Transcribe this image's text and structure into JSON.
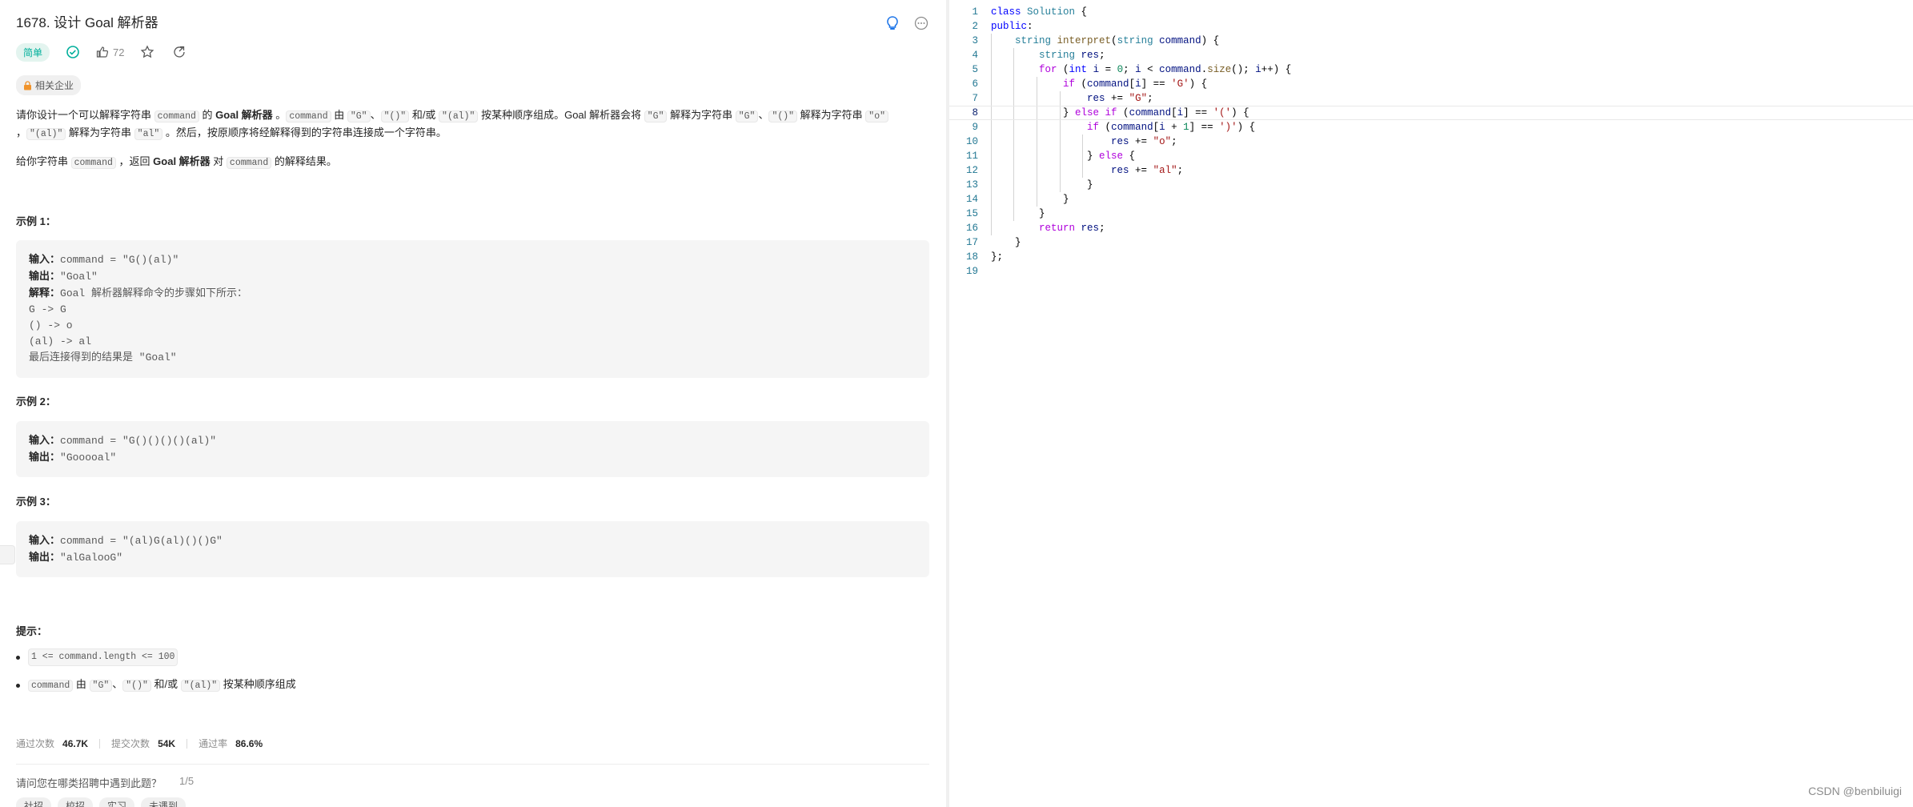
{
  "problem": {
    "title": "1678. 设计 Goal 解析器",
    "difficulty": "简单",
    "likes": "72",
    "company_tag": "相关企业"
  },
  "description": {
    "p1_a": "请你设计一个可以解释字符串 ",
    "p1_code1": "command",
    "p1_b": " 的 ",
    "p1_bold1": "Goal 解析器",
    "p1_c": " 。",
    "p1_code2": "command",
    "p1_d": " 由 ",
    "p1_code3": "\"G\"",
    "p1_e": "、",
    "p1_code4": "\"()\"",
    "p1_f": " 和/或 ",
    "p1_code5": "\"(al)\"",
    "p1_g": " 按某种顺序组成。Goal 解析器会将 ",
    "p1_code6": "\"G\"",
    "p1_h": " 解释为字符串 ",
    "p1_code7": "\"G\"",
    "p1_i": "、",
    "p1_code8": "\"()\"",
    "p1_j": " 解释为字符串 ",
    "p1_code9": "\"o\"",
    "p1_k": " ，",
    "p1_code10": "\"(al)\"",
    "p1_l": " 解释为字符串 ",
    "p1_code11": "\"al\"",
    "p1_m": " 。然后，按原顺序将经解释得到的字符串连接成一个字符串。",
    "p2_a": "给你字符串 ",
    "p2_code1": "command",
    "p2_b": " ，返回 ",
    "p2_bold1": "Goal 解析器",
    "p2_c": " 对 ",
    "p2_code2": "command",
    "p2_d": " 的解释结果。"
  },
  "examples": [
    {
      "title": "示例 1：",
      "input_label": "输入：",
      "input": "command = \"G()(al)\"",
      "output_label": "输出：",
      "output": "\"Goal\"",
      "explain_label": "解释：",
      "explain": "Goal 解析器解释命令的步骤如下所示：",
      "steps": [
        "G -> G",
        "() -> o",
        "(al) -> al",
        "最后连接得到的结果是 \"Goal\""
      ]
    },
    {
      "title": "示例 2：",
      "input_label": "输入：",
      "input": "command = \"G()()()()(al)\"",
      "output_label": "输出：",
      "output": "\"Gooooal\""
    },
    {
      "title": "示例 3：",
      "input_label": "输入：",
      "input": "command = \"(al)G(al)()()G\"",
      "output_label": "输出：",
      "output": "\"alGalooG\""
    }
  ],
  "hints": {
    "title": "提示：",
    "h1_code": "1 <= command.length <= 100",
    "h2_code1": "command",
    "h2_a": " 由 ",
    "h2_code2": "\"G\"",
    "h2_b": "、",
    "h2_code3": "\"()\"",
    "h2_c": " 和/或 ",
    "h2_code4": "\"(al)\"",
    "h2_d": " 按某种顺序组成"
  },
  "stats": {
    "accepted_label": "通过次数",
    "accepted": "46.7K",
    "submissions_label": "提交次数",
    "submissions": "54K",
    "rate_label": "通过率",
    "rate": "86.6%"
  },
  "survey": {
    "question": "请问您在哪类招聘中遇到此题？",
    "page": "1/5",
    "chips": [
      "社招",
      "校招",
      "实习",
      "未遇到"
    ]
  },
  "editor": {
    "line_numbers": [
      "1",
      "2",
      "3",
      "4",
      "5",
      "6",
      "7",
      "8",
      "9",
      "10",
      "11",
      "12",
      "13",
      "14",
      "15",
      "16",
      "17",
      "18",
      "19"
    ],
    "active_line": 8
  },
  "watermark": "CSDN @benbiluigi",
  "colors": {
    "easy": "#00af9b",
    "keyword": "#0000ff",
    "type": "#267f99",
    "string": "#a31515",
    "control": "#af00db"
  }
}
